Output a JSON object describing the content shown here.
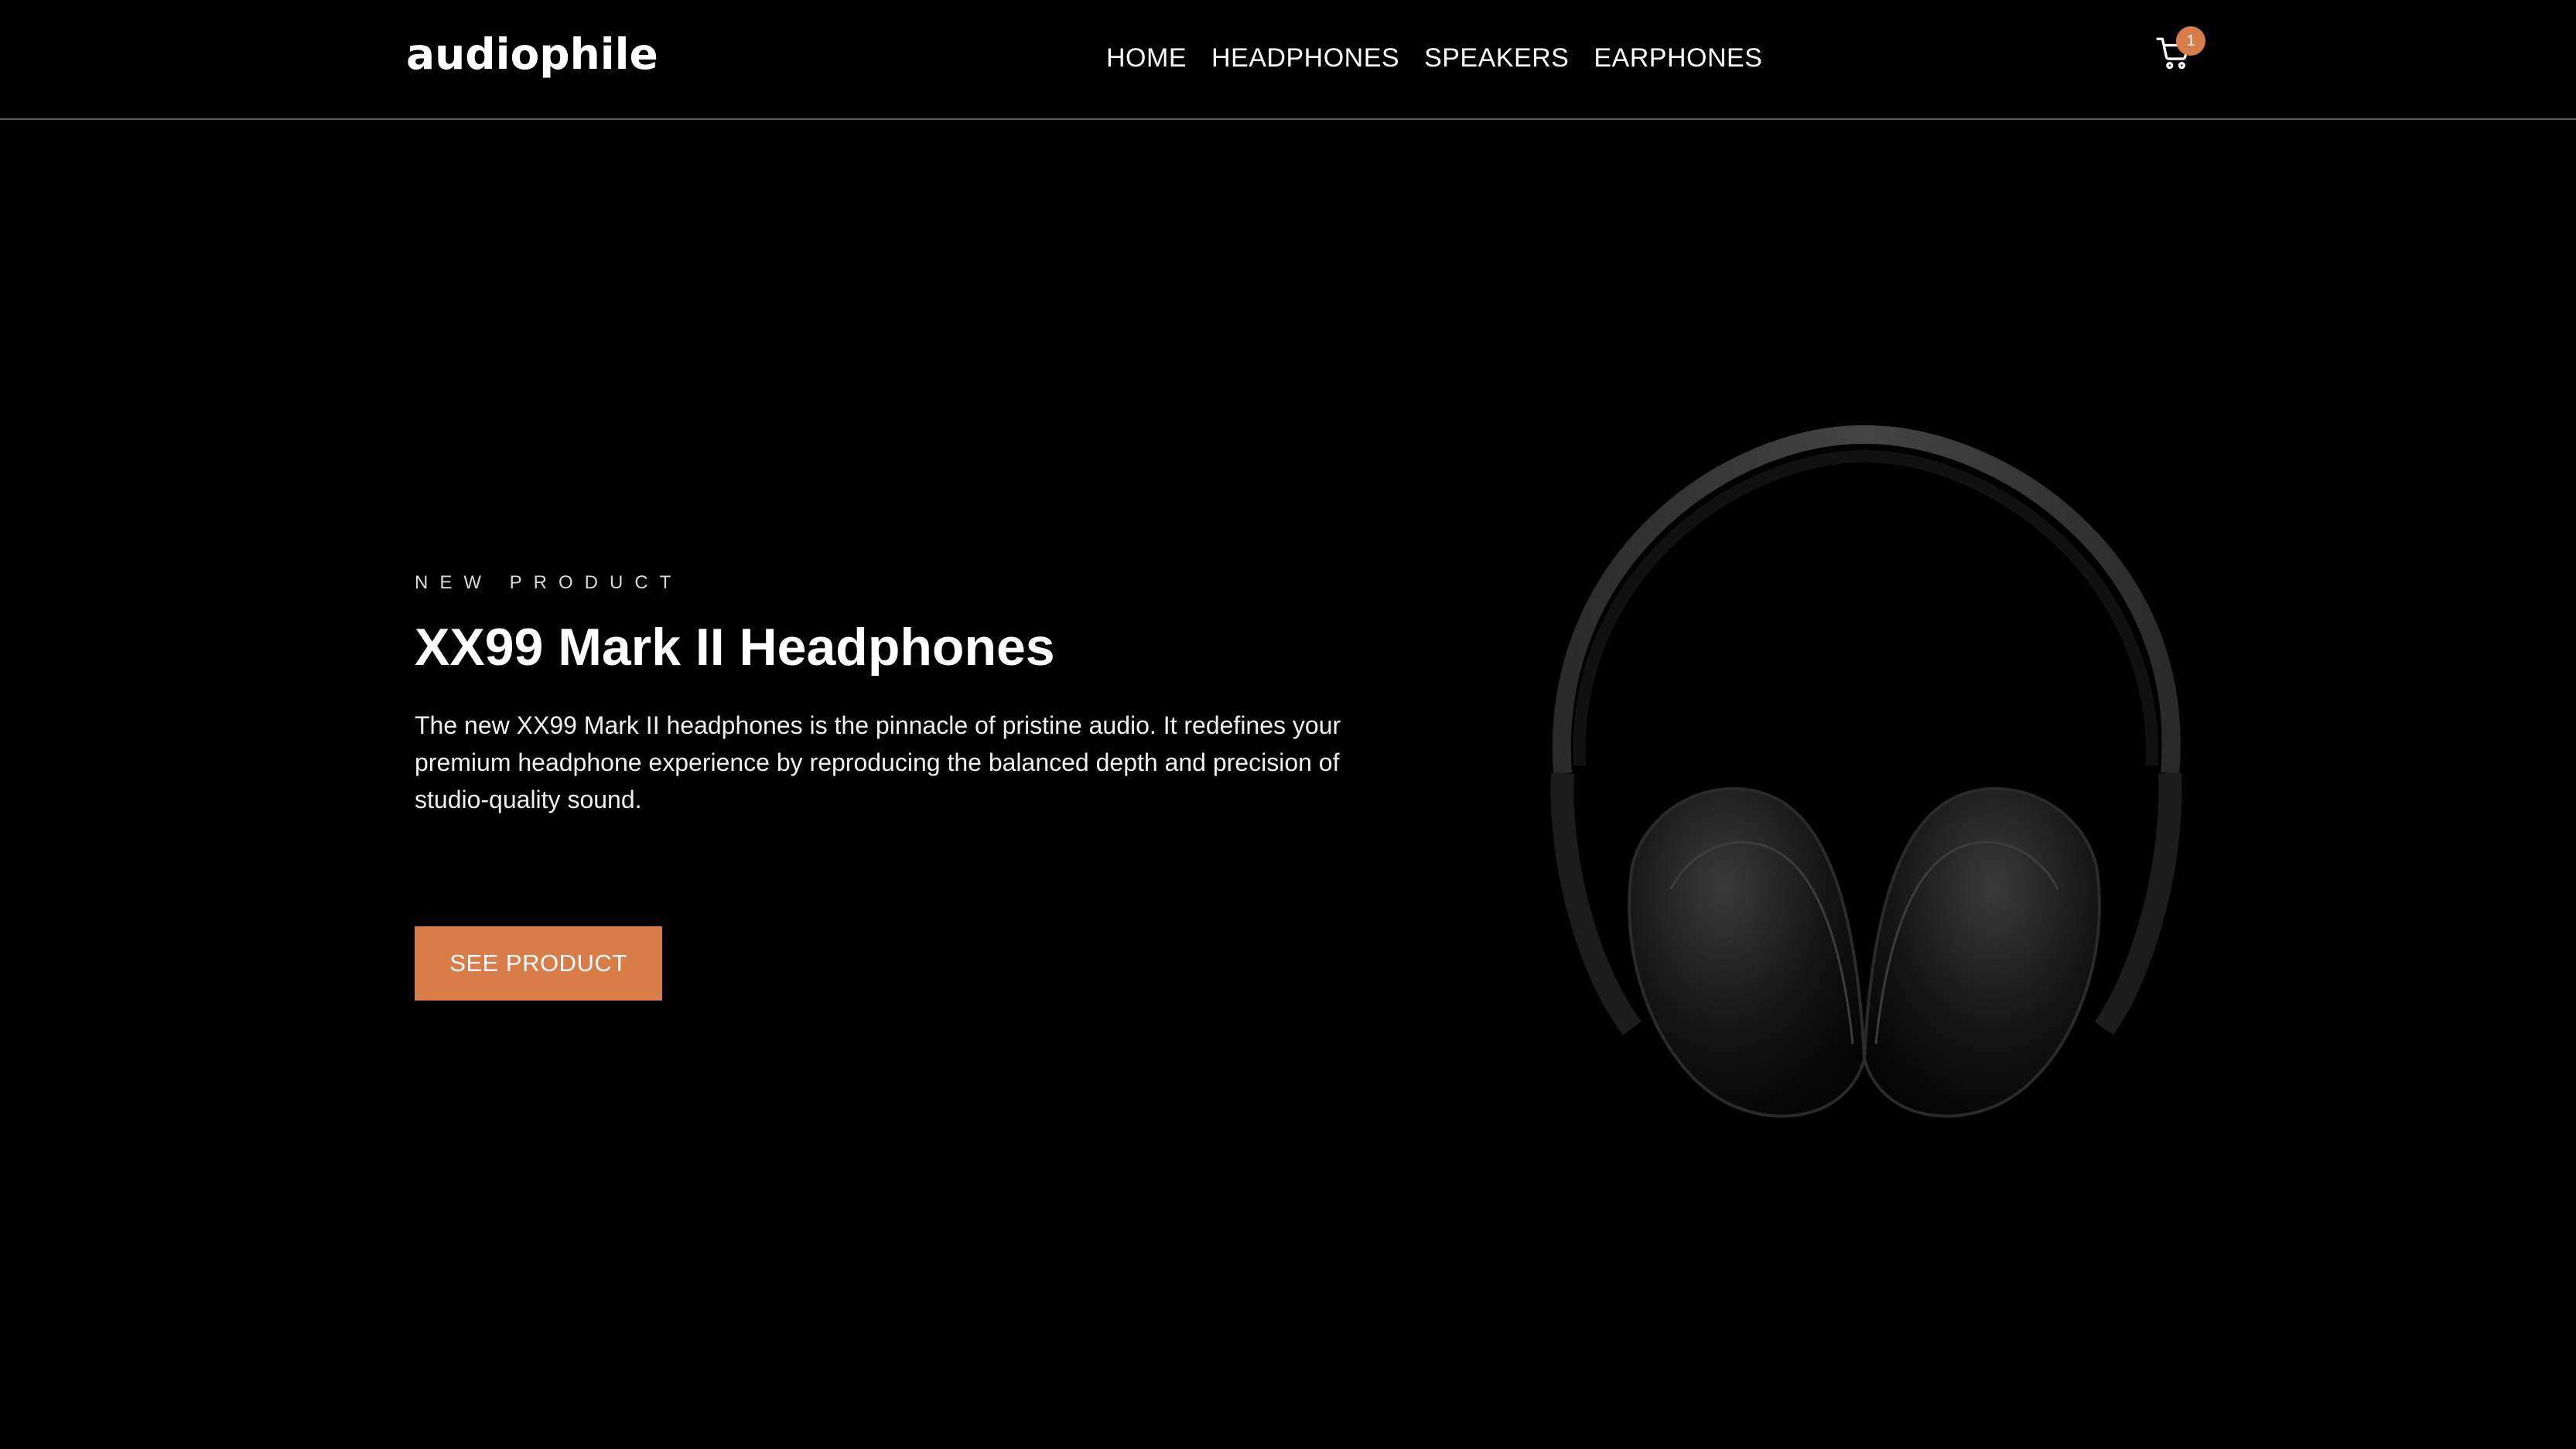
{
  "header": {
    "logo": "audiophile",
    "nav": [
      "HOME",
      "HEADPHONES",
      "SPEAKERS",
      "EARPHONES"
    ],
    "cart_count": "1",
    "cart_icon": "cart-icon"
  },
  "hero": {
    "overline": "NEW PRODUCT",
    "title": "XX99 Mark II Headphones",
    "description": "The new XX99 Mark II headphones is the pinnacle of pristine audio. It redefines your premium headphone experience by reproducing the balanced depth and precision of studio-quality sound.",
    "cta_label": "SEE PRODUCT",
    "image": "headphones-image"
  },
  "colors": {
    "accent": "#d87d4a",
    "background": "#000000"
  }
}
